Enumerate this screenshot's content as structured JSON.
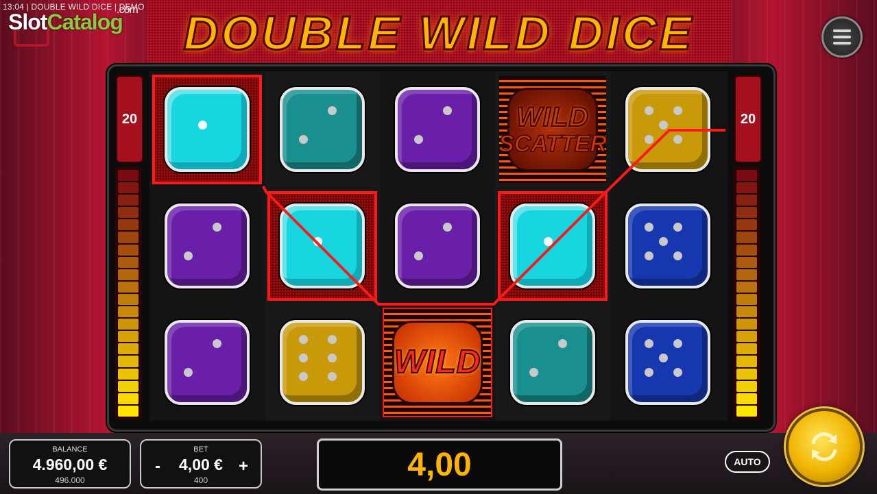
{
  "status": {
    "text": "13:04 | DOUBLE WILD DICE | DEMO"
  },
  "watermark": {
    "part1": "Slot",
    "part2": "Catalog",
    "suffix": ".com"
  },
  "game": {
    "title": "DOUBLE WILD DICE"
  },
  "lines": {
    "left": "20",
    "right": "20"
  },
  "reels": [
    [
      {
        "type": "die",
        "color": "cyan",
        "pips": 1,
        "win": true
      },
      {
        "type": "die",
        "color": "purple",
        "pips": 2,
        "win": false
      },
      {
        "type": "die",
        "color": "purple",
        "pips": 2,
        "win": false
      }
    ],
    [
      {
        "type": "die",
        "color": "cyan",
        "pips": 2,
        "win": false
      },
      {
        "type": "die",
        "color": "cyan",
        "pips": 1,
        "win": true
      },
      {
        "type": "die",
        "color": "yellow",
        "pips": 6,
        "win": false
      }
    ],
    [
      {
        "type": "die",
        "color": "purple",
        "pips": 2,
        "win": false
      },
      {
        "type": "die",
        "color": "purple",
        "pips": 2,
        "win": false
      },
      {
        "type": "wild",
        "label": "WILD",
        "win": true
      }
    ],
    [
      {
        "type": "scatter",
        "label1": "WILD",
        "label2": "SCATTER",
        "win": false
      },
      {
        "type": "die",
        "color": "cyan",
        "pips": 1,
        "win": true
      },
      {
        "type": "die",
        "color": "cyan",
        "pips": 2,
        "win": false
      }
    ],
    [
      {
        "type": "die",
        "color": "yellow",
        "pips": 5,
        "win": false
      },
      {
        "type": "die",
        "color": "blue",
        "pips": 5,
        "win": false
      },
      {
        "type": "die",
        "color": "blue",
        "pips": 5,
        "win": false
      }
    ]
  ],
  "footer": {
    "balance_label": "BALANCE",
    "balance_value": "4.960,00 €",
    "balance_credits": "496.000",
    "bet_label": "BET",
    "bet_value": "4,00 €",
    "bet_credits": "400",
    "bet_minus": "-",
    "bet_plus": "+",
    "win_value": "4,00",
    "auto_label": "AUTO"
  },
  "colors": {
    "accent": "#ff1a1a",
    "gold": "#ffb400",
    "meter_top": "#7a0a14",
    "meter_bottom": "#ffe600"
  },
  "icons": {
    "menu": "menu-icon",
    "spin": "spin-icon",
    "home": "home-icon"
  }
}
